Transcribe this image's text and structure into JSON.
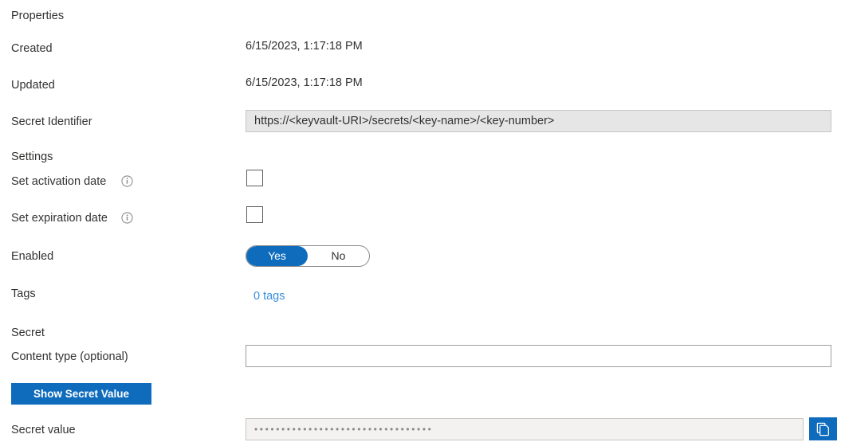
{
  "sections": {
    "properties_heading": "Properties",
    "settings_heading": "Settings",
    "secret_heading": "Secret"
  },
  "properties": {
    "created_label": "Created",
    "created_value": "6/15/2023, 1:17:18 PM",
    "updated_label": "Updated",
    "updated_value": "6/15/2023, 1:17:18 PM",
    "secret_identifier_label": "Secret Identifier",
    "secret_identifier_value": "https://<keyvault-URI>/secrets/<key-name>/<key-number>"
  },
  "settings": {
    "activation_date_label": "Set activation date",
    "activation_date_checked": false,
    "expiration_date_label": "Set expiration date",
    "expiration_date_checked": false,
    "enabled_label": "Enabled",
    "enabled_yes": "Yes",
    "enabled_no": "No",
    "enabled_selected": "Yes",
    "tags_label": "Tags",
    "tags_link": "0 tags"
  },
  "secret": {
    "content_type_label": "Content type (optional)",
    "content_type_value": "",
    "content_type_placeholder": "",
    "show_secret_button": "Show Secret Value",
    "secret_value_label": "Secret value",
    "secret_value_masked": "•••••••••••••••••••••••••••••••••"
  },
  "icons": {
    "info": "info-icon",
    "copy": "copy-icon"
  },
  "colors": {
    "accent_blue": "#0f6cbd",
    "link_blue": "#3b8ede",
    "text": "#323130",
    "field_border": "#a19f9d",
    "readonly_fill": "#e6e6e6"
  }
}
